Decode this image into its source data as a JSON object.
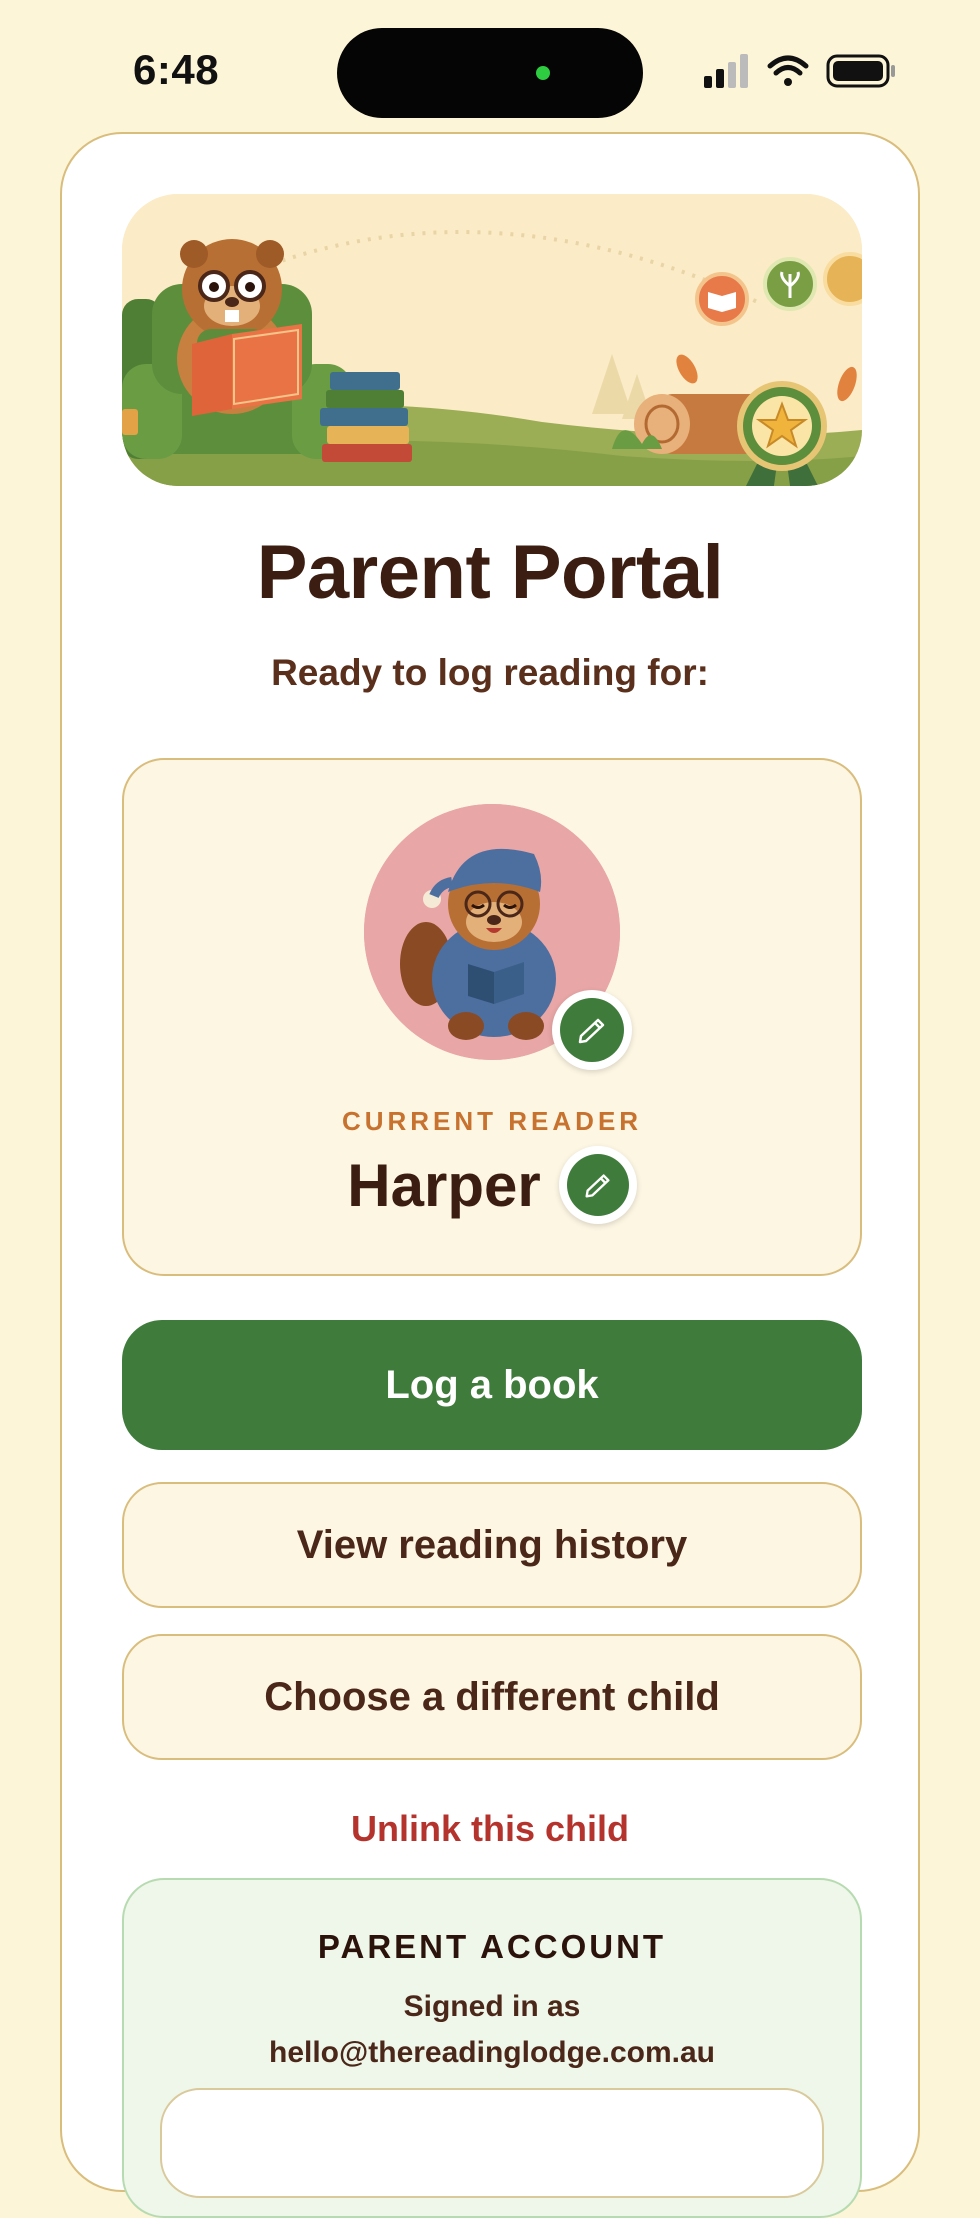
{
  "status_bar": {
    "time": "6:48"
  },
  "page": {
    "title": "Parent Portal",
    "subtitle": "Ready to log reading for:"
  },
  "reader": {
    "label": "CURRENT READER",
    "name": "Harper"
  },
  "actions": {
    "log_book": "Log a book",
    "view_history": "View reading history",
    "choose_child": "Choose a different child",
    "unlink": "Unlink this child"
  },
  "account": {
    "title": "PARENT ACCOUNT",
    "signed_in_label": "Signed in as",
    "email": "hello@thereadinglodge.com.au"
  },
  "colors": {
    "background": "#fdf5d8",
    "primary_green": "#3f7c3c",
    "text_brown": "#3b1d12",
    "accent_orange": "#c7722e",
    "danger_red": "#b5332d",
    "avatar_pink": "#e8a6a6"
  },
  "icons": {
    "signal": "cellular-signal-icon",
    "wifi": "wifi-icon",
    "battery": "battery-icon",
    "edit": "pencil-icon"
  }
}
